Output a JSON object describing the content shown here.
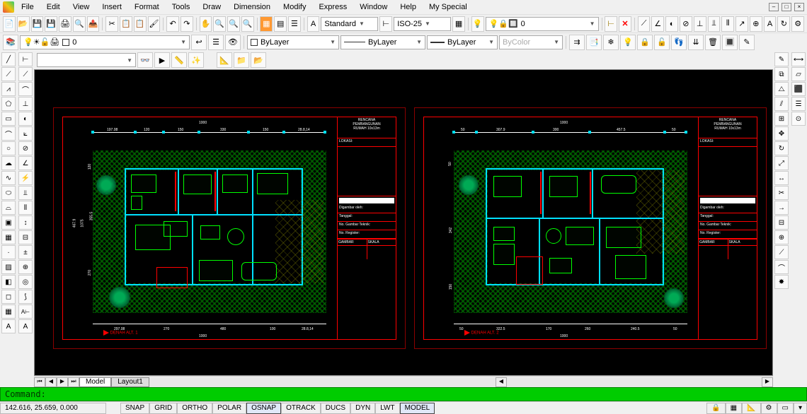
{
  "menu": [
    "File",
    "Edit",
    "View",
    "Insert",
    "Format",
    "Tools",
    "Draw",
    "Dimension",
    "Modify",
    "Express",
    "Window",
    "Help",
    "My Special"
  ],
  "toolbars": {
    "std": {
      "style_combo": "Standard",
      "dim_combo": "ISO-25"
    },
    "layer": {
      "current": "0",
      "linetype1": "ByLayer",
      "linetype2": "ByLayer",
      "linetype3": "ByLayer",
      "color": "ByColor"
    }
  },
  "tabs": {
    "model": "Model",
    "layout1": "Layout1"
  },
  "cmd": {
    "prompt": "Command:"
  },
  "status": {
    "coords": "142.616, 25.659, 0.000",
    "toggles": [
      "SNAP",
      "GRID",
      "ORTHO",
      "POLAR",
      "OSNAP",
      "OTRACK",
      "DUCS",
      "DYN",
      "LWT",
      "MODEL"
    ],
    "active": [
      "OSNAP",
      "MODEL"
    ]
  },
  "sheets": {
    "title_lines": [
      "RENCANA",
      "PEMBANGUNAN",
      "RUMAH 10x13m"
    ],
    "block_rows": [
      "LOKASI:",
      "",
      "Digambar oleh:",
      "Tanggal:",
      "No. Gambar Teknik:",
      "No. Register:"
    ],
    "block_foot_l": "GAMBAR",
    "block_foot_r": "SKALA",
    "alt1": "DENAH ALT. 1",
    "alt2": "DENAH ALT. 2",
    "dims_top1": [
      "197.08",
      "120",
      "150",
      "330",
      "150",
      "28.8,14"
    ],
    "dims_bot1": [
      "297.08",
      "270",
      "480",
      "100",
      "28.8,14"
    ],
    "overall1": "1000",
    "side1_top": "120",
    "side1_mid": "355.5",
    "side1_bot": "270",
    "side1_all": "1075",
    "side1_l": "467.9",
    "dims_top2": [
      "50",
      "307.9",
      "300",
      "457.5",
      "50"
    ],
    "dims_bot2": [
      "50",
      "322.5",
      "170",
      "260",
      "240.5",
      "50"
    ],
    "overall2": "1000",
    "side2_a": "50",
    "side2_b": "342",
    "side2_c": "150"
  }
}
